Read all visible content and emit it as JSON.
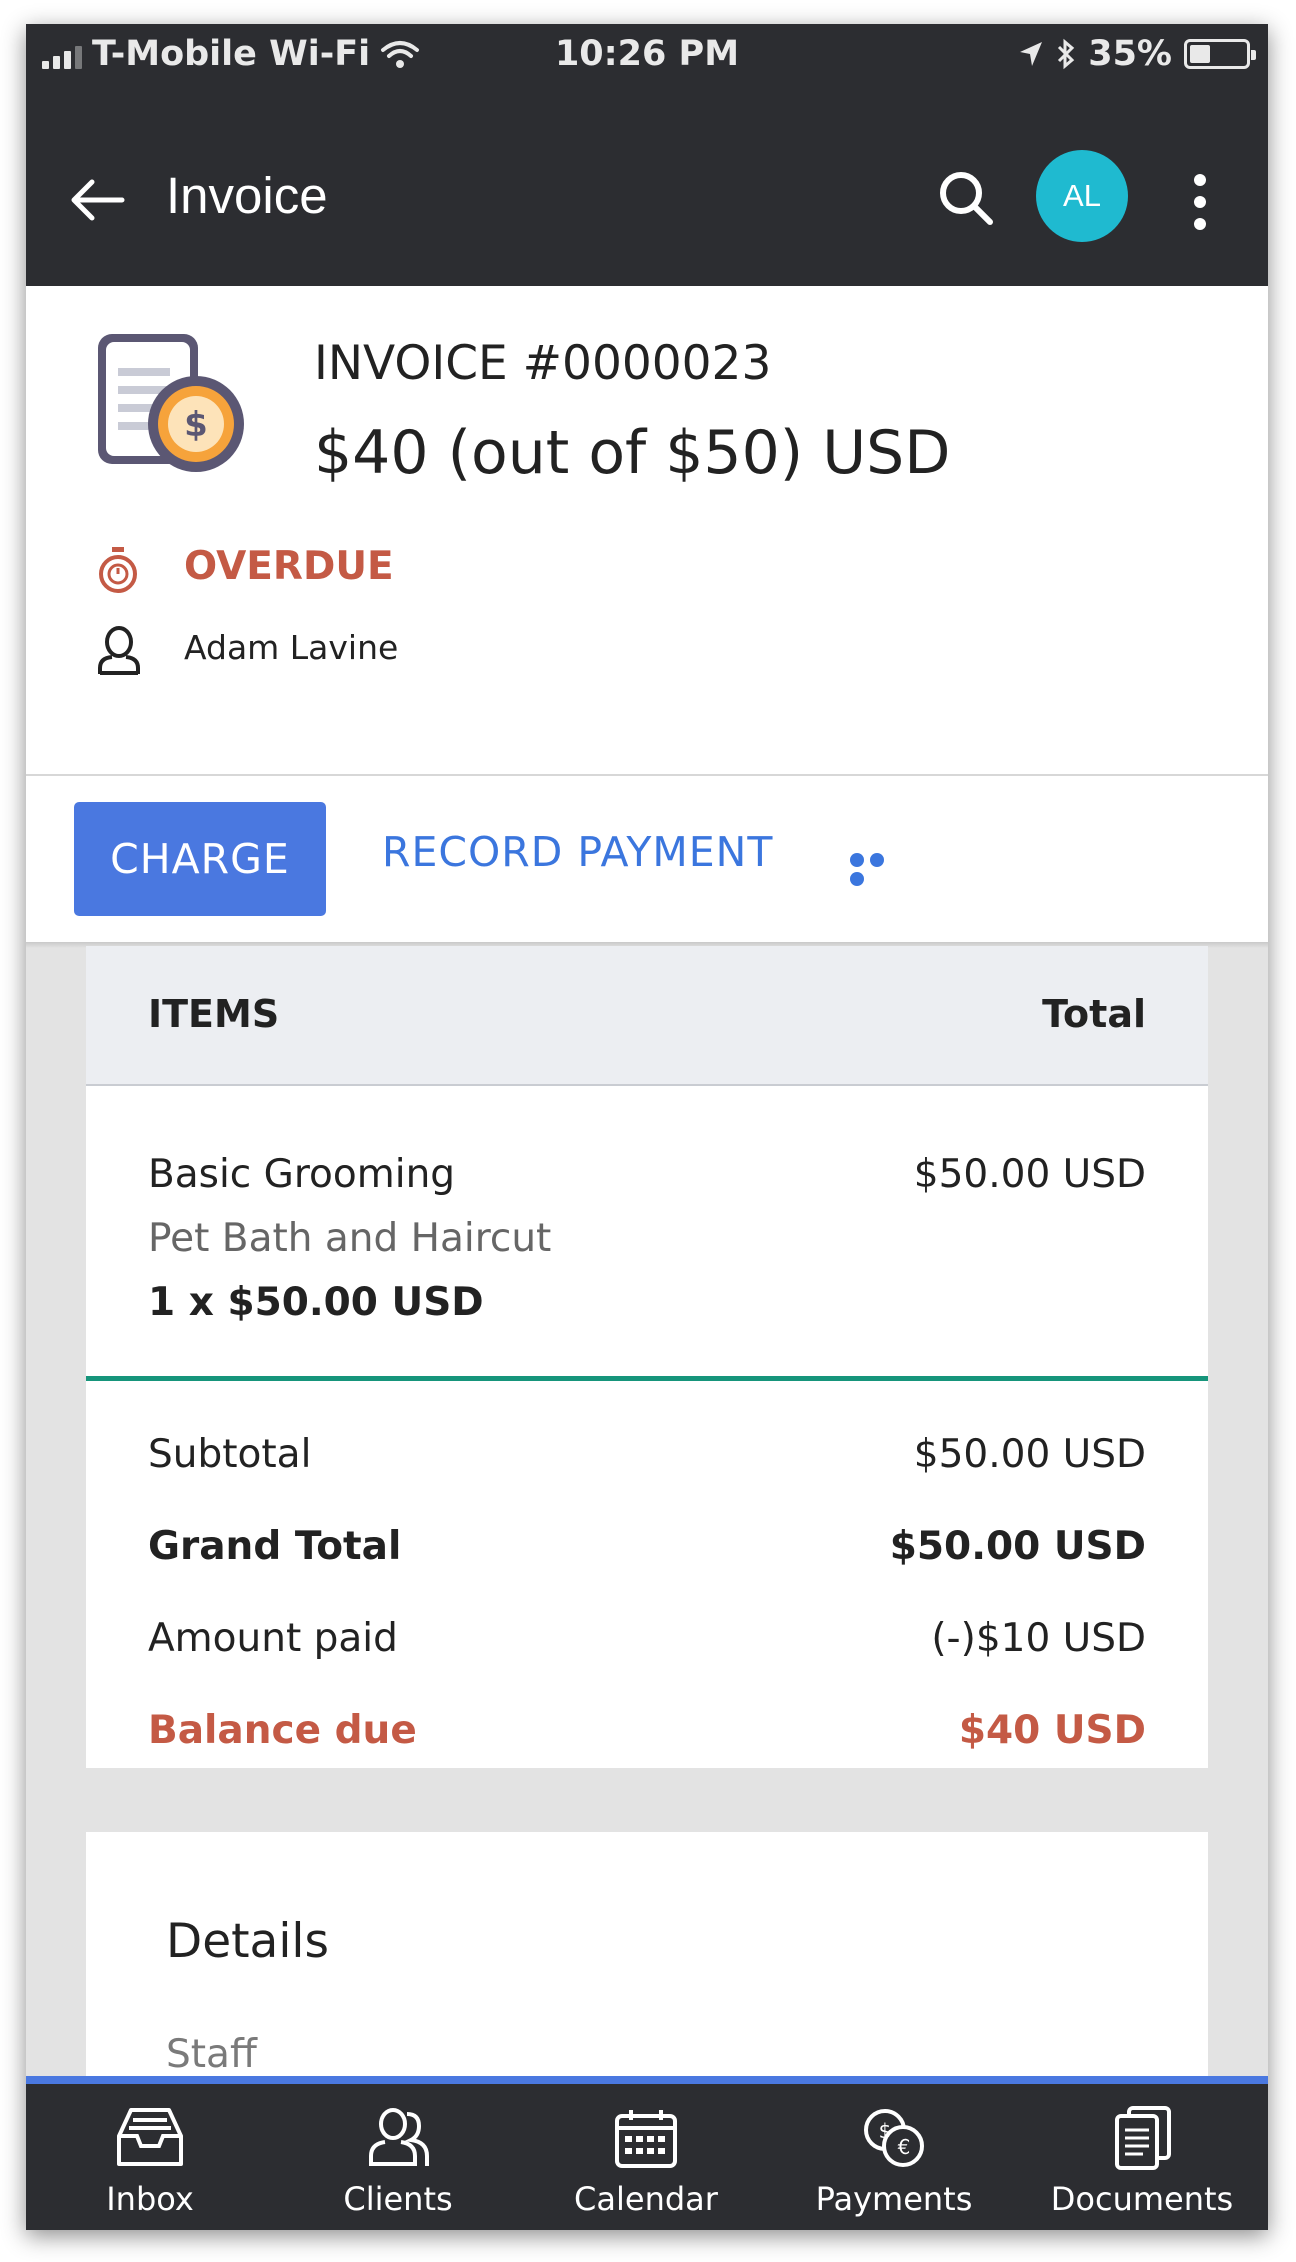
{
  "status_bar": {
    "carrier": "T-Mobile Wi-Fi",
    "time": "10:26 PM",
    "battery": "35%",
    "battery_level": 0.35
  },
  "app_bar": {
    "title": "Invoice",
    "avatar_initials": "AL",
    "avatar_color": "#1fbad0",
    "icons": [
      "back-arrow-icon",
      "search-icon",
      "more-vert-icon"
    ]
  },
  "invoice": {
    "number": "INVOICE #0000023",
    "amount": "$40 (out of $50) USD",
    "status": "OVERDUE",
    "client": "Adam Lavine"
  },
  "actions": {
    "charge": "CHARGE",
    "record_payment": "RECORD PAYMENT",
    "more": "more-horiz-icon"
  },
  "items": {
    "header_items": "ITEMS",
    "header_total": "Total",
    "rows": [
      {
        "name": "Basic Grooming",
        "description": "Pet Bath and Haircut",
        "quantity_line": "1 x $50.00 USD",
        "total": "$50.00 USD"
      }
    ]
  },
  "summary": {
    "subtotal_label": "Subtotal",
    "subtotal_value": "$50.00 USD",
    "grand_total_label": "Grand Total",
    "grand_total_value": "$50.00 USD",
    "amount_paid_label": "Amount paid",
    "amount_paid_value": "(-)$10 USD",
    "balance_due_label": "Balance due",
    "balance_due_value": "$40 USD"
  },
  "details": {
    "title": "Details",
    "staff_label": "Staff"
  },
  "bottom_nav": {
    "items": [
      {
        "label": "Inbox",
        "icon": "inbox-icon"
      },
      {
        "label": "Clients",
        "icon": "clients-icon"
      },
      {
        "label": "Calendar",
        "icon": "calendar-icon"
      },
      {
        "label": "Payments",
        "icon": "payments-icon"
      },
      {
        "label": "Documents",
        "icon": "documents-icon"
      }
    ]
  },
  "colors": {
    "dark_bar": "#2c2d31",
    "primary_blue": "#4a78e0",
    "overdue_red": "#c45a45",
    "divider_green": "#16957b"
  }
}
